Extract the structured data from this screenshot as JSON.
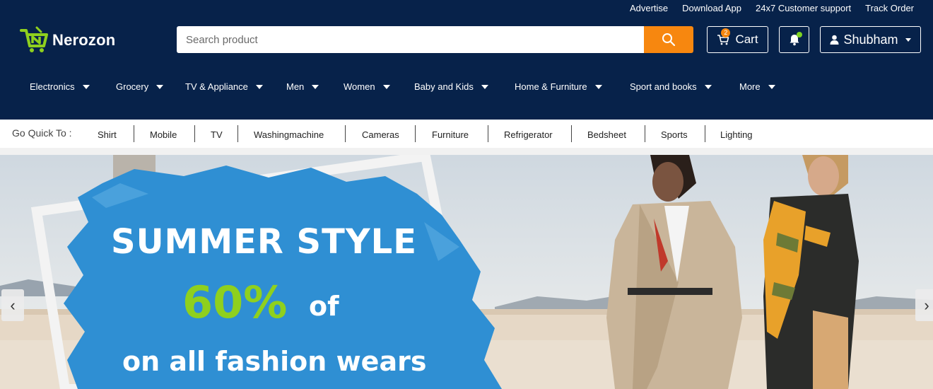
{
  "brand": {
    "name": "Nerozon",
    "accent": "#8fd01e",
    "header_bg": "#07224a",
    "button_color": "#f7870f"
  },
  "top_links": [
    "Advertise",
    "Download App",
    "24x7 Customer support",
    "Track Order"
  ],
  "search": {
    "placeholder": "Search product",
    "button_icon": "search-icon"
  },
  "cart": {
    "label": "Cart",
    "count": "2"
  },
  "notifications": {
    "icon": "bell-icon"
  },
  "user": {
    "name": "Shubham"
  },
  "categories": [
    "Electronics",
    "Grocery",
    "TV & Appliance",
    "Men",
    "Women",
    "Baby and Kids",
    "Home & Furniture",
    "Sport and books",
    "More"
  ],
  "quick": {
    "title": "Go Quick To :",
    "items": [
      "Shirt",
      "Mobile",
      "TV",
      "Washingmachine",
      "Cameras",
      "Furniture",
      "Refrigerator",
      "Bedsheet",
      "Sports",
      "Lighting"
    ]
  },
  "banner": {
    "line1": "SUMMER STYLE",
    "percent": "60%",
    "of": "of",
    "line3": "on all fashion wears",
    "prev_icon": "‹",
    "next_icon": "›"
  }
}
